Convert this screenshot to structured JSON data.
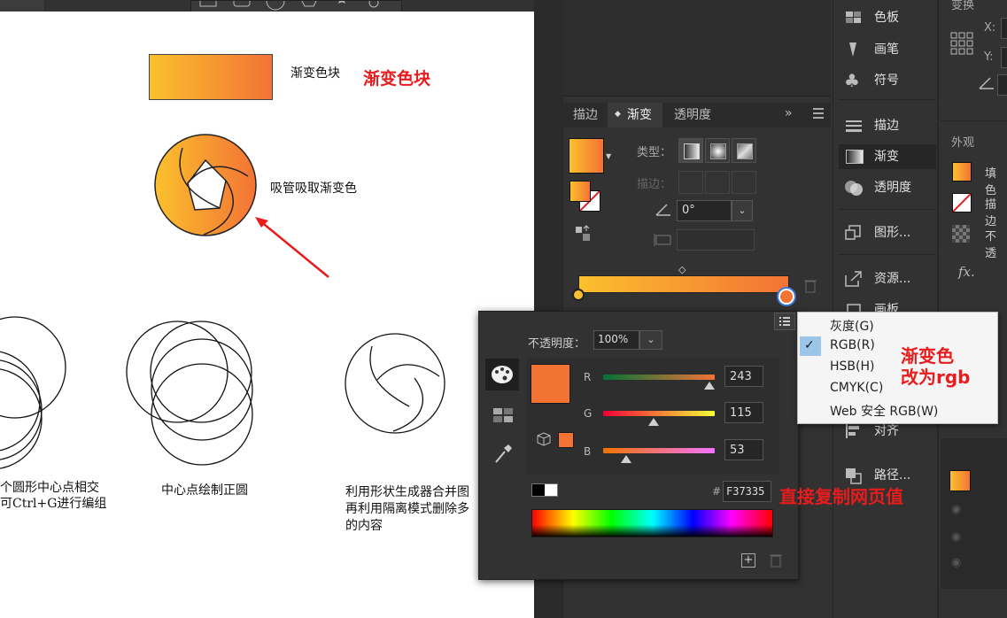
{
  "canvas": {
    "swatch_label": "渐变色块",
    "swatch_note": "渐变色块",
    "eyedropper_label": "吸管吸取渐变色",
    "caption1_line1": "个圆形中心点相交",
    "caption1_line2": "可Ctrl+G进行编组",
    "caption2": "中心点绘制正圆",
    "caption3_line1": "利用形状生成器合并图",
    "caption3_line2": "再利用隔离模式删除多",
    "caption3_line3": "的内容"
  },
  "gradient_panel": {
    "tabs": [
      "描边",
      "渐变",
      "透明度"
    ],
    "type_label": "类型：",
    "stroke_label": "描边：",
    "angle_value": "0°"
  },
  "right_panel": {
    "items": [
      {
        "label": "色板",
        "icon": "swatches-icon"
      },
      {
        "label": "画笔",
        "icon": "brush-icon"
      },
      {
        "label": "符号",
        "icon": "club-icon"
      },
      {
        "label": "描边",
        "icon": "stroke-lines-icon"
      },
      {
        "label": "渐变",
        "icon": "gradient-icon"
      },
      {
        "label": "透明度",
        "icon": "transparency-icon"
      },
      {
        "label": "图形...",
        "icon": "graphic-styles-icon"
      },
      {
        "label": "资源...",
        "icon": "export-icon"
      },
      {
        "label": "画板",
        "icon": "artboard-icon"
      },
      {
        "label": "对齐",
        "icon": "align-icon"
      },
      {
        "label": "路径...",
        "icon": "pathfinder-icon"
      }
    ]
  },
  "far_right": {
    "transform_title": "变换",
    "x_label": "X:",
    "y_label": "Y:",
    "appearance_title": "外观",
    "fill_label": "填色",
    "stroke_label": "描边",
    "opacity_label": "不透",
    "fx_label": "fx."
  },
  "color_popup": {
    "opacity_label": "不透明度：",
    "opacity_value": "100%",
    "r_label": "R",
    "g_label": "G",
    "b_label": "B",
    "r_value": "243",
    "g_value": "115",
    "b_value": "53",
    "r_fraction": 0.953,
    "g_fraction": 0.451,
    "b_fraction": 0.208,
    "hash": "#",
    "hex_value": "F37335",
    "note": "直接复制网页值",
    "color": "#f37335"
  },
  "mode_menu": {
    "items": [
      "灰度(G)",
      "RGB(R)",
      "HSB(H)",
      "CMYK(C)",
      "Web 安全 RGB(W)"
    ],
    "checked_index": 1,
    "note_line1": "渐变色",
    "note_line2": "改为rgb"
  },
  "colors": {
    "gradient_start": "#fbc02d",
    "gradient_end": "#f37335",
    "annotation_red": "#e81c1c"
  }
}
